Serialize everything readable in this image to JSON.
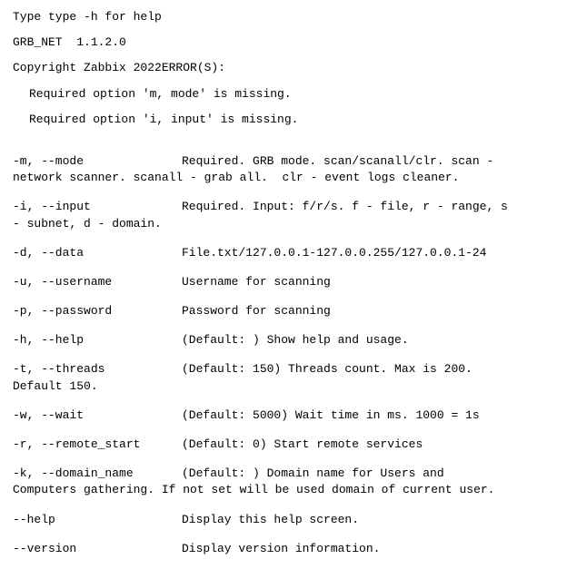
{
  "header": {
    "help_hint": "Type type -h for help",
    "program_name": "GRB_NET  1.1.2.0",
    "copyright_line": "Copyright Zabbix 2022ERROR(S):"
  },
  "errors": {
    "missing_mode": "Required option 'm, mode' is missing.",
    "missing_input": "Required option 'i, input' is missing."
  },
  "options": {
    "mode": {
      "flag": "-m, --mode",
      "desc_line1": "Required. GRB mode. scan/scanall/clr. scan -",
      "desc_line2": "network scanner. scanall - grab all.  clr - event logs cleaner."
    },
    "input": {
      "flag": "-i, --input",
      "desc_line1": "Required. Input: f/r/s. f - file, r - range, s",
      "desc_line2": "- subnet, d - domain."
    },
    "data": {
      "flag": "-d, --data",
      "desc": "File.txt/127.0.0.1-127.0.0.255/127.0.0.1-24"
    },
    "username": {
      "flag": "-u, --username",
      "desc": "Username for scanning"
    },
    "password": {
      "flag": "-p, --password",
      "desc": "Password for scanning"
    },
    "help": {
      "flag": "-h, --help",
      "desc": "(Default: ) Show help and usage."
    },
    "threads": {
      "flag": "-t, --threads",
      "desc_line1": "(Default: 150) Threads count. Max is 200.",
      "desc_line2": "Default 150."
    },
    "wait": {
      "flag": "-w, --wait",
      "desc": "(Default: 5000) Wait time in ms. 1000 = 1s"
    },
    "remote_start": {
      "flag": "-r, --remote_start",
      "desc": "(Default: 0) Start remote services"
    },
    "domain_name": {
      "flag": "-k, --domain_name",
      "desc_line1": "(Default: ) Domain name for Users and",
      "desc_line2": "Computers gathering. If not set will be used domain of current user."
    },
    "help_long": {
      "flag": "--help",
      "desc": "Display this help screen."
    },
    "version": {
      "flag": "--version",
      "desc": "Display version information."
    }
  }
}
